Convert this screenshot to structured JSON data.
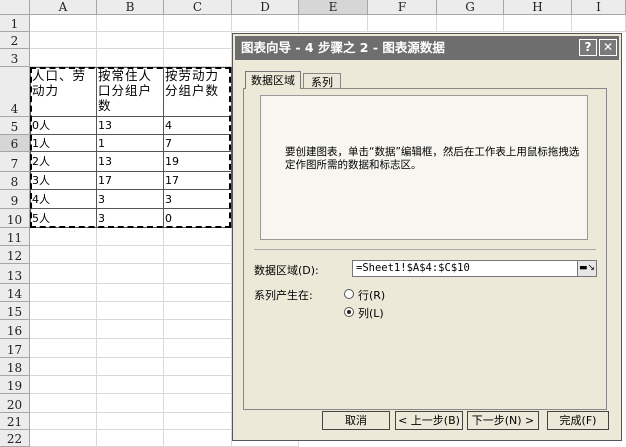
{
  "sheet": {
    "columns": [
      "A",
      "B",
      "C",
      "D",
      "E",
      "F",
      "G",
      "H",
      "I"
    ],
    "selected_column": "E",
    "rows": [
      "1",
      "2",
      "3",
      "4",
      "5",
      "6",
      "7",
      "8",
      "9",
      "10",
      "11",
      "12",
      "13",
      "14",
      "15",
      "16",
      "17",
      "18",
      "19",
      "20",
      "21",
      "22"
    ],
    "selected_row": "6",
    "header_row": [
      "人口、劳动力",
      "按常住人口分组户数",
      "按劳动力分组户数"
    ],
    "data_rows": [
      [
        "0人",
        "13",
        "4"
      ],
      [
        "1人",
        "1",
        "7"
      ],
      [
        "2人",
        "13",
        "19"
      ],
      [
        "3人",
        "17",
        "17"
      ],
      [
        "4人",
        "3",
        "3"
      ],
      [
        "5人",
        "3",
        "0"
      ]
    ]
  },
  "dialog": {
    "title": "图表向导 - 4 步骤之 2 - 图表源数据",
    "help_button": "?",
    "close_button": "✕",
    "tabs": [
      "数据区域",
      "系列"
    ],
    "active_tab": "数据区域",
    "instruction": "要创建图表，单击“数据”编辑框，然后在工作表上用鼠标拖拽选定作图所需的数据和标志区。",
    "range_label": "数据区域(D):",
    "range_value": "=Sheet1!$A$4:$C$10",
    "series_in_label": "系列产生在:",
    "options": [
      {
        "label": "行(R)",
        "selected": false
      },
      {
        "label": "列(L)",
        "selected": true
      }
    ],
    "buttons": {
      "cancel": "取消",
      "back": "< 上一步(B)",
      "next": "下一步(N) >",
      "finish": "完成(F)"
    }
  }
}
